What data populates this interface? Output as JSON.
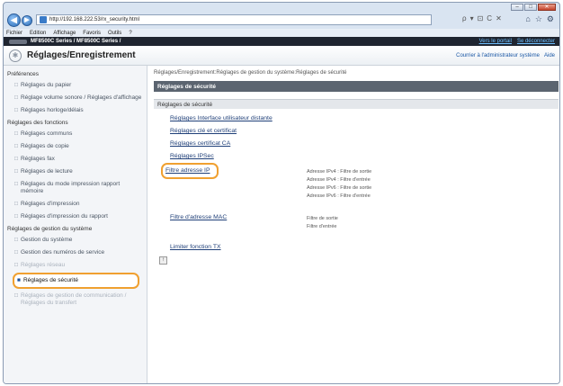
{
  "browser": {
    "window_buttons": [
      "–",
      "□",
      "✕"
    ],
    "url": "http://192.168.222.53/rx_security.html",
    "addr_tools": [
      "ρ",
      "▾",
      "⊡",
      "C",
      "✕"
    ],
    "icons": [
      "home-icon",
      "star-icon",
      "gear-icon"
    ],
    "menu": [
      "Fichier",
      "Edition",
      "Affichage",
      "Favoris",
      "Outils",
      "?"
    ]
  },
  "topbar": {
    "title": "MF8500C Series / MF8500C Series /",
    "portal_link": "Vers le portail",
    "logout_link": "Se déconnecter"
  },
  "header": {
    "title": "Réglages/Enregistrement",
    "mail_link": "Courrier à l'administrateur système",
    "help_link": "Aide"
  },
  "sidebar": {
    "groups": [
      {
        "label": "Préférences",
        "items": [
          "Réglages du papier",
          "Réglage volume sonore / Réglages d'affichage",
          "Réglages horloge/délais"
        ]
      },
      {
        "label": "Réglages des fonctions",
        "items": [
          "Réglages communs",
          "Réglages de copie",
          "Réglages fax",
          "Réglages de lecture",
          "Réglages du mode impression rapport mémoire",
          "Réglages d'impression",
          "Réglages d'impression du rapport"
        ]
      },
      {
        "label": "Réglages de gestion du système",
        "items": [
          "Gestion du système",
          "Gestion des numéros de service",
          "Réglages réseau",
          "Réglages de sécurité",
          "Réglages de gestion de communication / Réglages du transfert"
        ]
      }
    ]
  },
  "main": {
    "breadcrumb": "Réglages/Enregistrement:Réglages de gestion du système:Réglages de sécurité",
    "section_title": "Réglages de sécurité",
    "subsection_title": "Réglages de sécurité",
    "links": [
      "Réglages Interface utilisateur distante",
      "Réglages clé et certificat",
      "Réglages certificat CA",
      "Réglages IPSec",
      "Filtre adresse IP",
      "Filtre d'adresse MAC",
      "Limiter fonction TX"
    ],
    "ip_filter_desc": [
      "Adresse IPv4 : Filtre de sortie",
      "Adresse IPv4 : Filtre d'entrée",
      "Adresse IPv6 : Filtre de sortie",
      "Adresse IPv6 : Filtre d'entrée"
    ],
    "mac_filter_desc": [
      "Filtre de sortie",
      "Filtre d'entrée"
    ],
    "page_button": "↑"
  }
}
